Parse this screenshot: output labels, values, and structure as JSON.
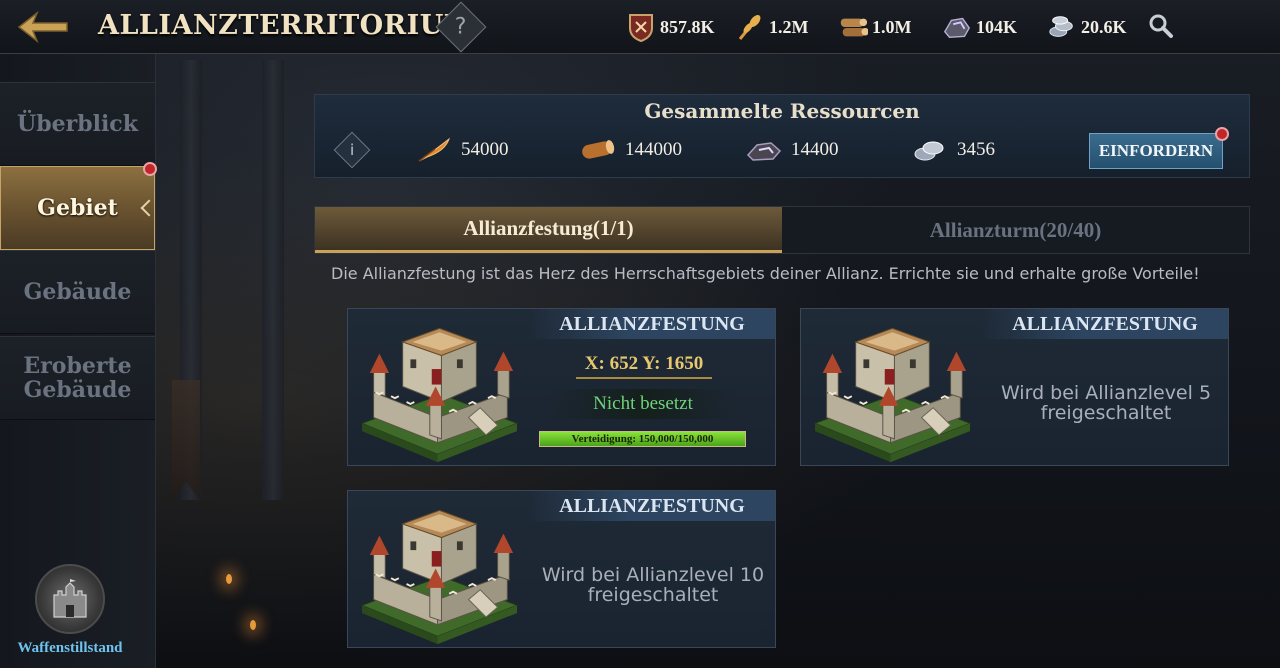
{
  "header": {
    "title": "ALLIANZTERRITORIUM",
    "help_label": "?",
    "resources": [
      {
        "icon": "power-shield-icon",
        "value": "857.8K"
      },
      {
        "icon": "wheat-icon",
        "value": "1.2M"
      },
      {
        "icon": "wood-icon",
        "value": "1.0M"
      },
      {
        "icon": "ore-icon",
        "value": "104K"
      },
      {
        "icon": "silver-icon",
        "value": "20.6K"
      }
    ]
  },
  "sidebar": {
    "items": [
      {
        "label": "Überblick"
      },
      {
        "label": "Gebiet"
      },
      {
        "label": "Gebäude"
      },
      {
        "label": "Eroberte Gebäude"
      }
    ],
    "truce_label": "Waffenstillstand"
  },
  "collected": {
    "title": "Gesammelte Ressourcen",
    "info_label": "i",
    "items": [
      {
        "icon": "feather-food-icon",
        "value": "54000"
      },
      {
        "icon": "log-icon",
        "value": "144000"
      },
      {
        "icon": "iron-ore-icon",
        "value": "14400"
      },
      {
        "icon": "silver-coins-icon",
        "value": "3456"
      }
    ],
    "claim_label": "EINFORDERN"
  },
  "tabs": [
    {
      "label": "Allianzfestung(1/1)"
    },
    {
      "label": "Allianzturm(20/40)"
    }
  ],
  "description": "Die Allianzfestung ist das Herz des Herrschaftsgebiets deiner Allianz. Errichte sie und erhalte große Vorteile!",
  "cards": [
    {
      "title": "ALLIANZFESTUNG",
      "coords": "X: 652 Y: 1650",
      "status": "Nicht besetzt",
      "defense_text": "Verteidigung: 150,000/150,000",
      "defense_fraction": 1.0
    },
    {
      "title": "ALLIANZFESTUNG",
      "locked_text": "Wird bei Allianzlevel 5 freigeschaltet"
    },
    {
      "title": "ALLIANZFESTUNG",
      "locked_text": "Wird bei Allianzlevel 10 freigeschaltet"
    }
  ],
  "colors": {
    "gold_accent": "#c9a257",
    "status_green": "#6fd27a",
    "claim_blue": "#24506e",
    "notify_red": "#c0262a"
  }
}
